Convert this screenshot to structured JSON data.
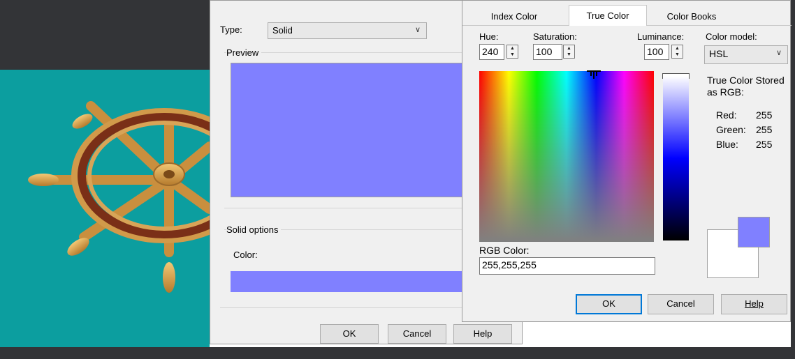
{
  "gradient_dialog": {
    "type_label": "Type:",
    "type_value": "Solid",
    "preview_label": "Preview",
    "preview_color": "#8080ff",
    "solid_options_label": "Solid options",
    "color_label": "Color:",
    "swatch_color": "#8080ff",
    "ok_label": "OK",
    "cancel_label": "Cancel",
    "help_label": "Help"
  },
  "color_dialog": {
    "tabs": [
      "Index Color",
      "True Color",
      "Color Books"
    ],
    "active_tab": "True Color",
    "hue_label": "Hue:",
    "hue_value": "240",
    "saturation_label": "Saturation:",
    "saturation_value": "100",
    "luminance_label": "Luminance:",
    "luminance_value": "100",
    "color_model_label": "Color model:",
    "color_model_value": "HSL",
    "stored_label": "True Color Stored as RGB:",
    "red_label": "Red:",
    "red_value": "255",
    "green_label": "Green:",
    "green_value": "255",
    "blue_label": "Blue:",
    "blue_value": "255",
    "rgb_label": "RGB Color:",
    "rgb_value": "255,255,255",
    "new_color": "#8080ff",
    "old_color": "#ffffff",
    "ok_label": "OK",
    "cancel_label": "Cancel",
    "help_label": "Help"
  },
  "colors": {
    "viewport_bg": "#0c9e9f",
    "dark_bg": "#333437",
    "dialog_bg": "#f0f0f0",
    "accent": "#0078d7"
  }
}
